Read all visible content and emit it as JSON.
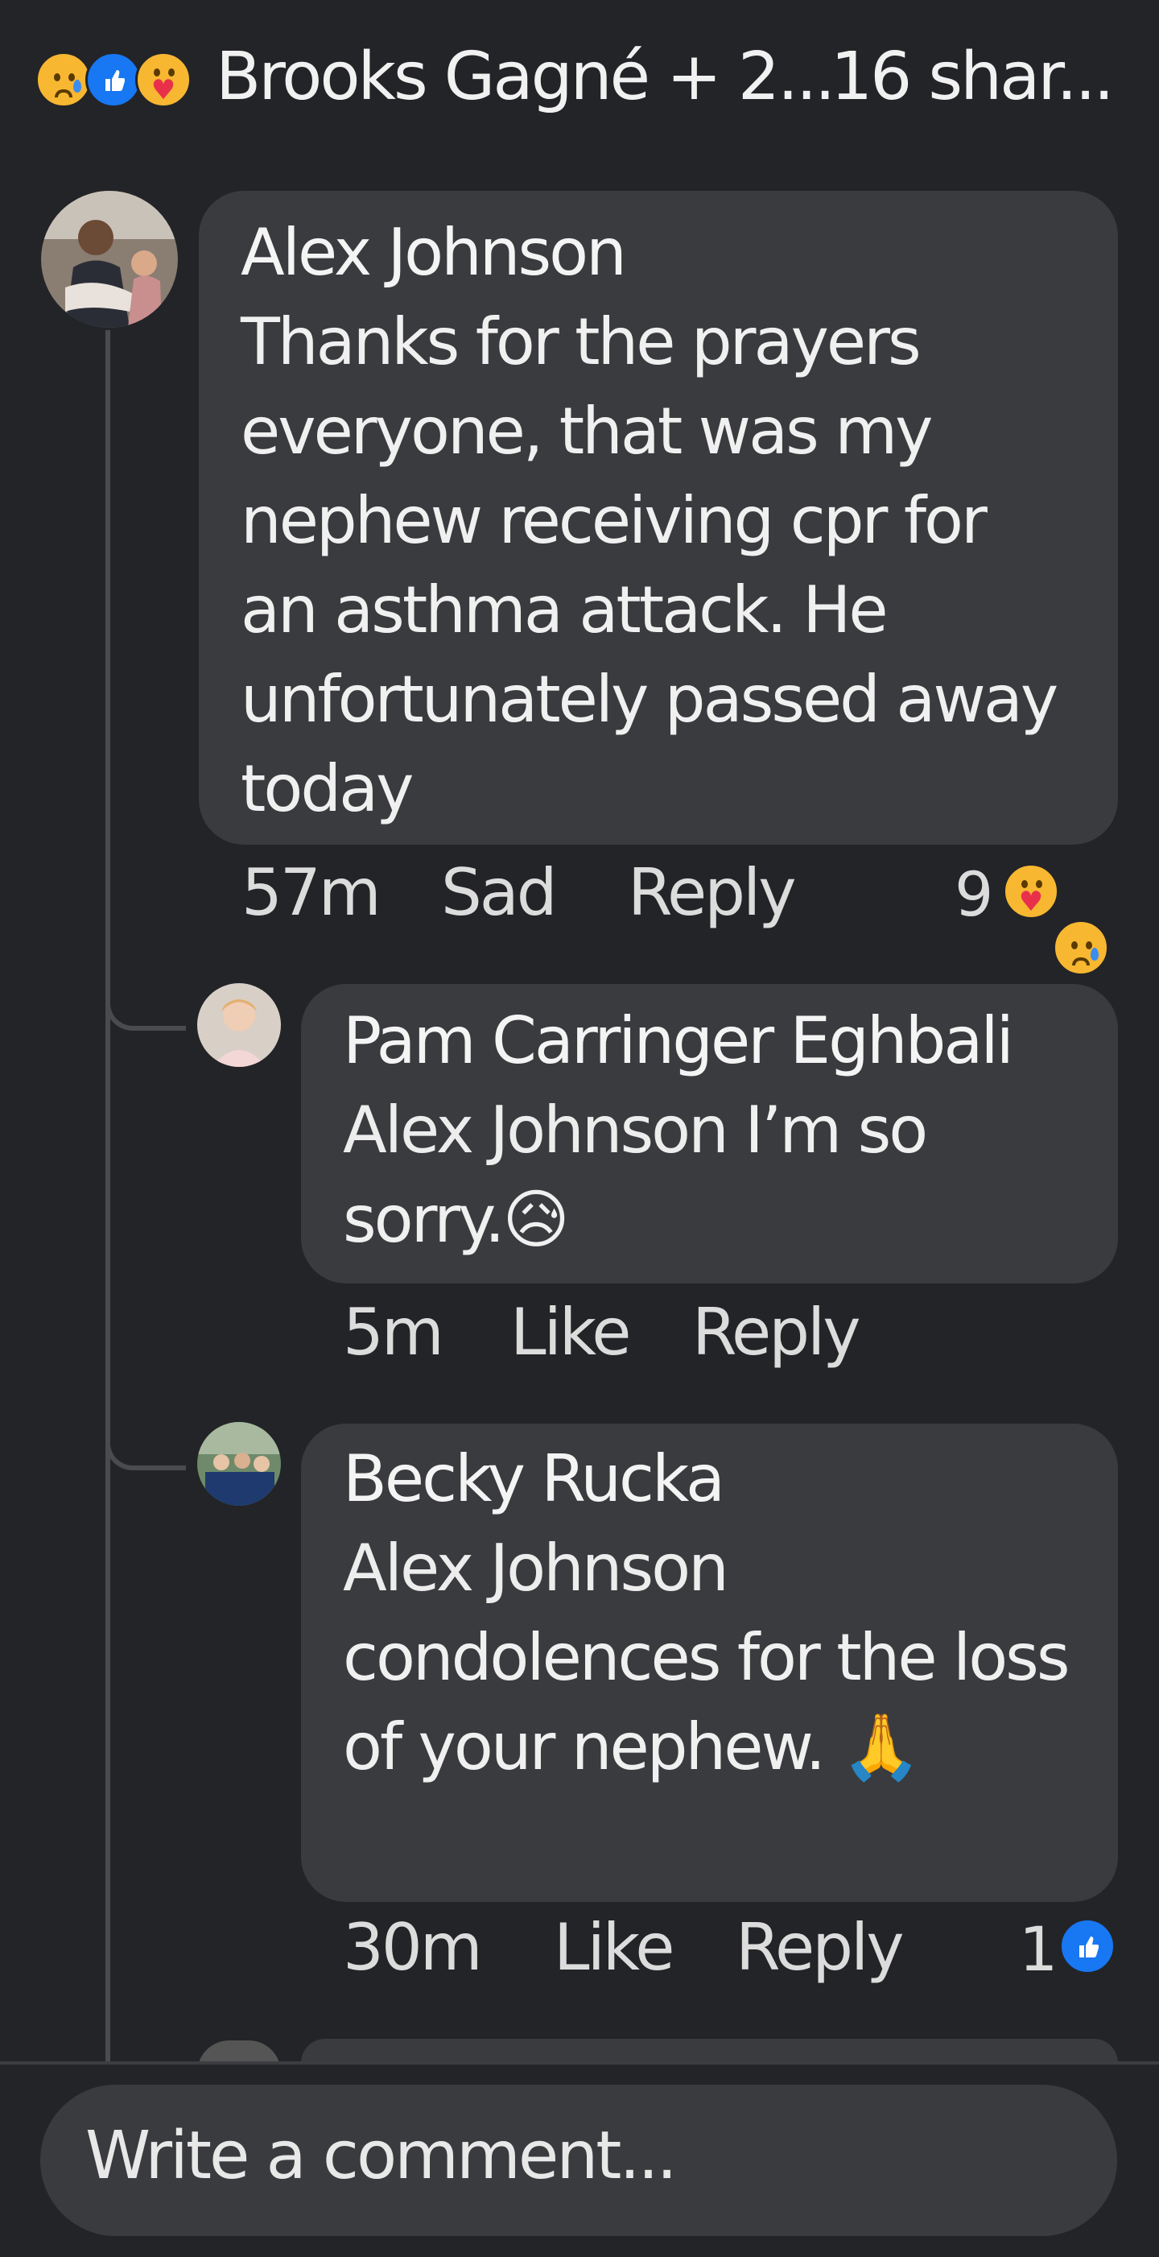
{
  "header": {
    "reactions": [
      "sad-reaction",
      "like-reaction",
      "care-reaction"
    ],
    "reactors_text": "Brooks Gagné + 2...",
    "shares_text": "16 shar..."
  },
  "comments": [
    {
      "author": "Alex Johnson",
      "text": "Thanks for the prayers everyone, that was my nephew receiving cpr for an asthma attack. He unfortunately passed away today",
      "time": "57m",
      "reaction_label": "Sad",
      "reply_label": "Reply",
      "reaction_count": "9",
      "reactions": [
        "care-reaction",
        "sad-reaction"
      ]
    }
  ],
  "replies": [
    {
      "author": "Pam Carringer Eghbali",
      "mention": "Alex Johnson",
      "text": " I’m so sorry.😥",
      "time": "5m",
      "like_label": "Like",
      "reply_label": "Reply"
    },
    {
      "author": "Becky Rucka",
      "mention": "Alex Johnson",
      "text": "condolences for the loss of your nephew. 🙏",
      "time": "30m",
      "like_label": "Like",
      "reply_label": "Reply",
      "reaction_count": "1",
      "reactions": [
        "like-reaction"
      ]
    }
  ],
  "composer": {
    "placeholder": "Write a comment..."
  },
  "colors": {
    "background": "#232427",
    "bubble": "#3a3b3e",
    "like_blue": "#1877f2",
    "sad_yellow": "#f7b731"
  }
}
